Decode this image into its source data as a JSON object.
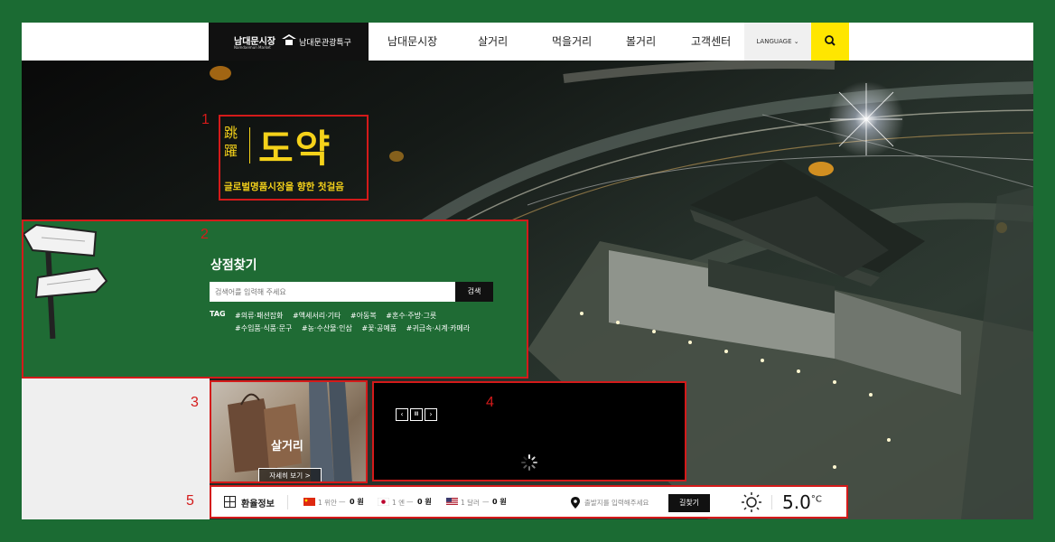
{
  "logo": {
    "main": "남대문시장",
    "main_sub": "Namdaemun Market",
    "district": "남대문관광특구"
  },
  "nav": {
    "items": [
      "남대문시장",
      "살거리",
      "먹을거리",
      "볼거리",
      "고객센터"
    ],
    "language": "LANGUAGE"
  },
  "hero": {
    "slogan_hanja": "跳躍",
    "slogan_big": "도약",
    "slogan_sub": "글로벌명품시장을 향한 첫걸음"
  },
  "store_search": {
    "title": "상점찾기",
    "placeholder": "검색어를 입력해 주세요",
    "button": "검색",
    "tag_label": "TAG",
    "tags": [
      "#의류·패션잡화",
      "#액세서리·기타",
      "#아동복",
      "#혼수·주방·그릇",
      "#수입품·식품·문구",
      "#농·수산물·인삼",
      "#꽃·공예품",
      "#귀금속·시계·카메라"
    ]
  },
  "shop_card": {
    "label": "살거리",
    "more": "자세히 보기 >"
  },
  "annotations": [
    "1",
    "2",
    "3",
    "4",
    "5"
  ],
  "info_bar": {
    "exchange_title": "환율정보",
    "rates": [
      {
        "unit": "1 위안",
        "value": "0 원"
      },
      {
        "unit": "1 엔",
        "value": "0 원"
      },
      {
        "unit": "1 달러",
        "value": "0 원"
      }
    ],
    "destination_placeholder": "출발지를 입력해주세요",
    "find_route": "길찾기",
    "temperature": "5.0",
    "temp_unit": "°C"
  },
  "colors": {
    "brand_green": "#1f6b34",
    "accent_yellow": "#ffe600",
    "annotation_red": "#d41a1a"
  }
}
